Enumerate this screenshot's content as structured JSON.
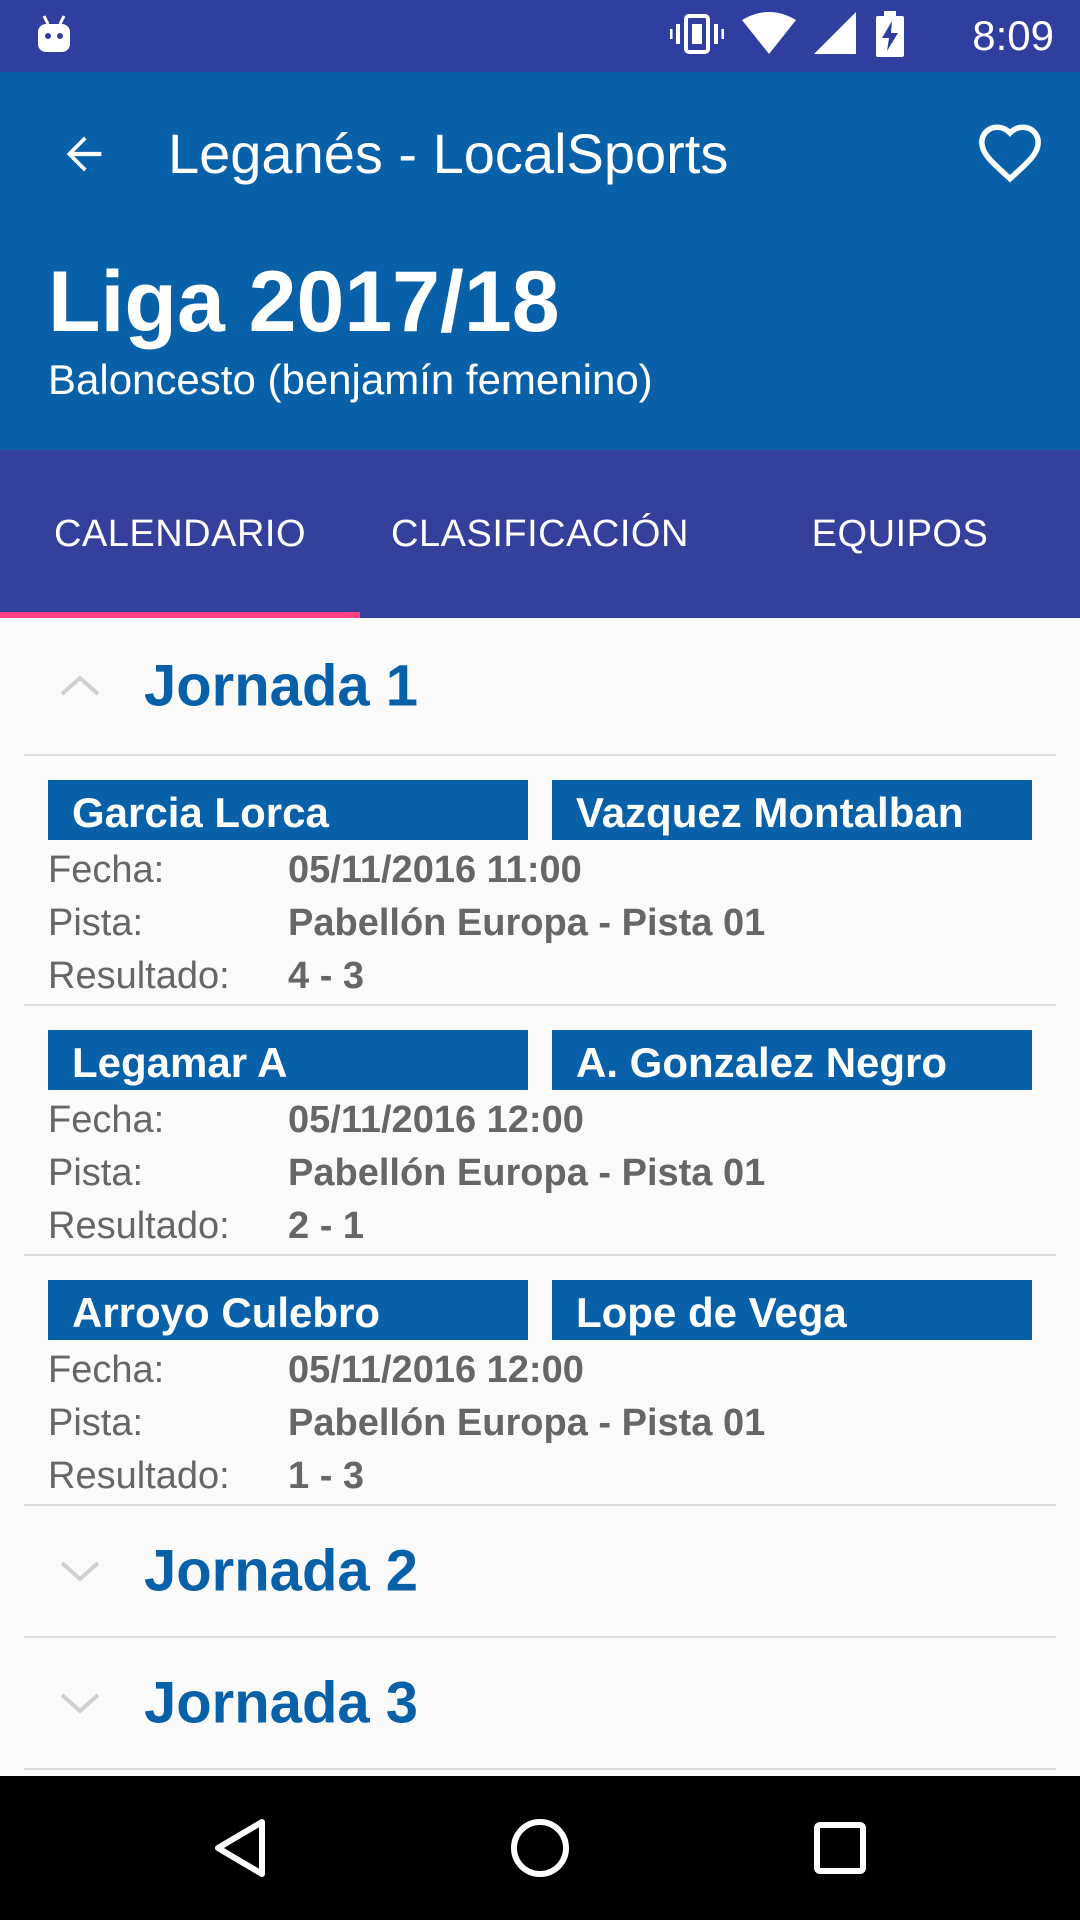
{
  "status_bar": {
    "time": "8:09",
    "icons": [
      "android-debug-icon",
      "vibrate-icon",
      "wifi-icon",
      "signal-icon",
      "battery-charging-icon"
    ]
  },
  "app_bar": {
    "title": "Leganés - LocalSports",
    "league_title": "Liga 2017/18",
    "league_subtitle": "Baloncesto (benjamín femenino)",
    "icons": [
      "back-arrow-icon",
      "heart-icon"
    ]
  },
  "tabs": [
    {
      "label": "CALENDARIO",
      "active": true
    },
    {
      "label": "CLASIFICACIÓN",
      "active": false
    },
    {
      "label": "EQUIPOS",
      "active": false
    }
  ],
  "labels": {
    "fecha": "Fecha:",
    "pista": "Pista:",
    "resultado": "Resultado:"
  },
  "jornadas": [
    {
      "title": "Jornada 1",
      "expanded": true,
      "matches": [
        {
          "home": "Garcia Lorca",
          "away": "Vazquez Montalban",
          "fecha": "05/11/2016 11:00",
          "pista": "Pabellón Europa - Pista 01",
          "resultado": "4 - 3"
        },
        {
          "home": "Legamar A",
          "away": "A. Gonzalez Negro",
          "fecha": "05/11/2016 12:00",
          "pista": "Pabellón Europa - Pista 01",
          "resultado": "2 - 1"
        },
        {
          "home": "Arroyo Culebro",
          "away": "Lope de Vega",
          "fecha": "05/11/2016 12:00",
          "pista": "Pabellón Europa - Pista 01",
          "resultado": "1 - 3"
        }
      ]
    },
    {
      "title": "Jornada 2",
      "expanded": false
    },
    {
      "title": "Jornada 3",
      "expanded": false
    }
  ],
  "colors": {
    "status_bar": "#303f9f",
    "app_bar": "#0861a8",
    "tabs": "#353f9c",
    "tab_indicator": "#ff4081",
    "accent_text": "#0861a8"
  },
  "nav_bar": {
    "icons": [
      "back-triangle-icon",
      "home-circle-icon",
      "recents-square-icon"
    ]
  }
}
